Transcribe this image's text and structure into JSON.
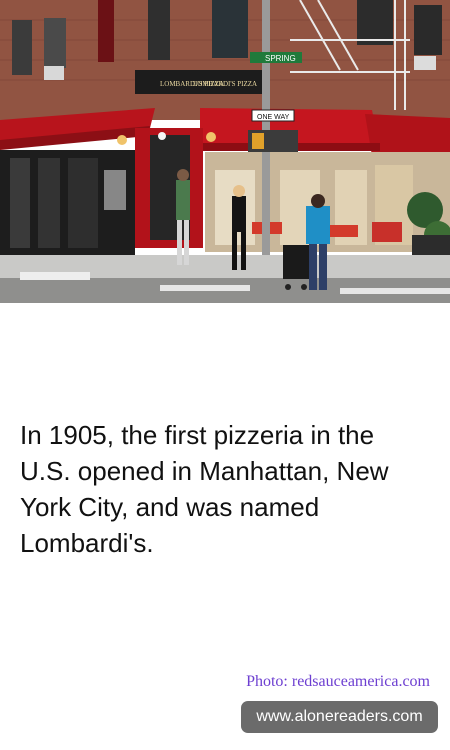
{
  "photo": {
    "storefront_signs": [
      "LOMBARDI'S PIZZA",
      "LOMBARDI'S PIZZA"
    ],
    "street_sign": "SPRING",
    "one_way_sign": "ONE WAY"
  },
  "fact": {
    "text": "In 1905, the first pizzeria in the U.S. opened in Manhattan, New York City, and was named Lombardi's."
  },
  "credit": {
    "text": "Photo: redsauceamerica.com"
  },
  "footer": {
    "site": "www.alonereaders.com"
  },
  "colors": {
    "text": "#111111",
    "credit": "#6d3fd1",
    "badge_bg": "#6b6b6b",
    "awning_red": "#b8141c"
  }
}
